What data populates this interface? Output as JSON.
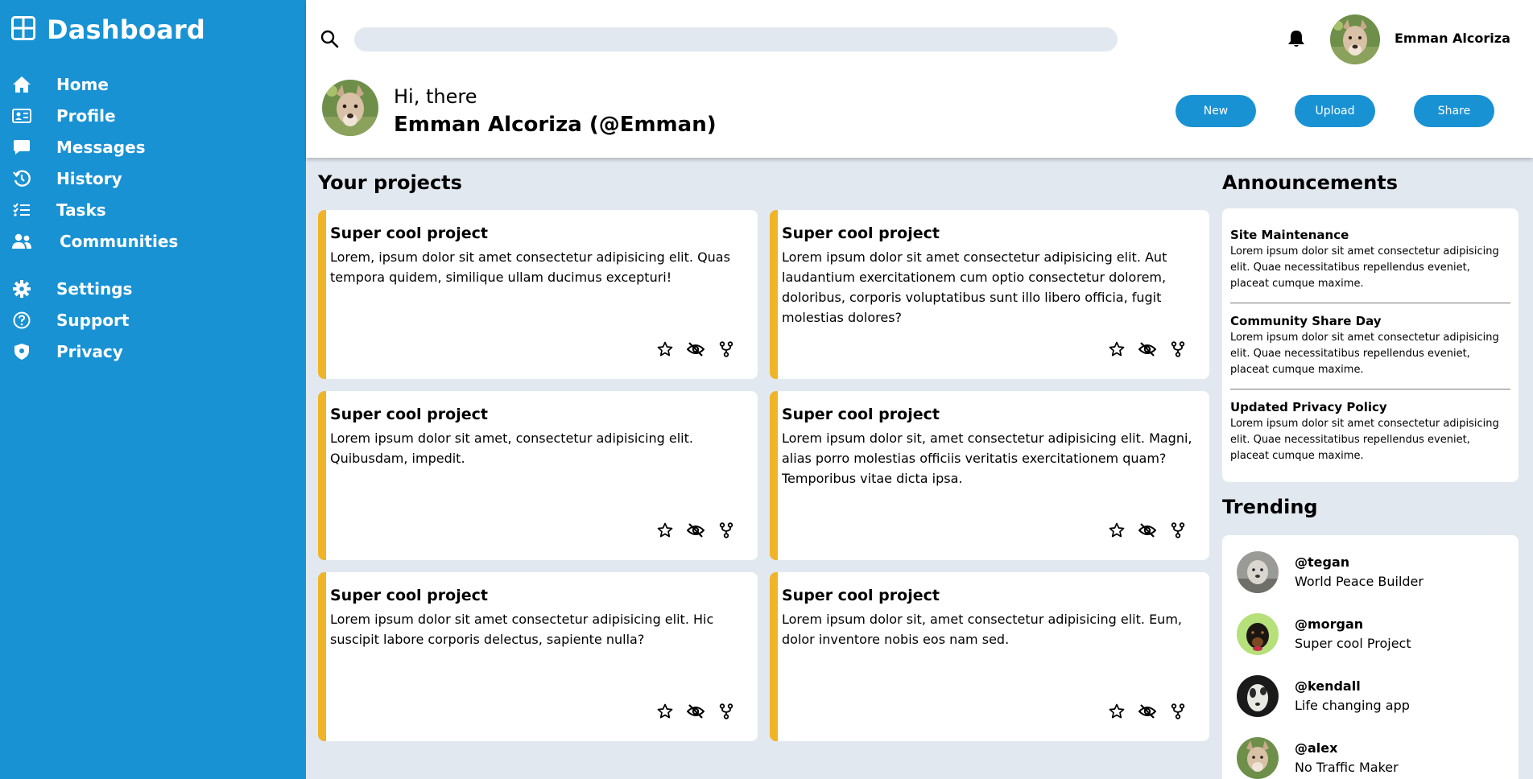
{
  "sidebar": {
    "brand": {
      "title": "Dashboard",
      "icon": "grid-icon"
    },
    "items": [
      {
        "label": "Home",
        "icon": "home-icon"
      },
      {
        "label": "Profile",
        "icon": "id-card-icon"
      },
      {
        "label": "Messages",
        "icon": "message-icon"
      },
      {
        "label": "History",
        "icon": "history-icon"
      },
      {
        "label": "Tasks",
        "icon": "tasks-icon"
      },
      {
        "label": "Communities",
        "icon": "users-icon"
      },
      {
        "label": "Settings",
        "icon": "gear-icon"
      },
      {
        "label": "Support",
        "icon": "help-icon"
      },
      {
        "label": "Privacy",
        "icon": "shield-icon"
      }
    ]
  },
  "header": {
    "search": {
      "placeholder": ""
    },
    "user": {
      "name": "Emman Alcoriza"
    },
    "greeting": "Hi, there",
    "greeting_name": "Emman Alcoriza (@Emman)",
    "buttons": {
      "new": "New",
      "upload": "Upload",
      "share": "Share"
    }
  },
  "projects": {
    "title": "Your projects",
    "cards": [
      {
        "title": "Super cool project",
        "text": "Lorem, ipsum dolor sit amet consectetur adipisicing elit. Quas tempora quidem, similique ullam ducimus excepturi!"
      },
      {
        "title": "Super cool project",
        "text": "Lorem ipsum dolor sit amet consectetur adipisicing elit. Aut laudantium exercitationem cum optio consectetur dolorem, doloribus, corporis voluptatibus sunt illo libero officia, fugit molestias dolores?"
      },
      {
        "title": "Super cool project",
        "text": "Lorem ipsum dolor sit amet, consectetur adipisicing elit. Quibusdam, impedit."
      },
      {
        "title": "Super cool project",
        "text": "Lorem ipsum dolor sit, amet consectetur adipisicing elit. Magni, alias porro molestias officiis veritatis exercitationem quam? Temporibus vitae dicta ipsa."
      },
      {
        "title": "Super cool project",
        "text": "Lorem ipsum dolor sit amet consectetur adipisicing elit. Hic suscipit labore corporis delectus, sapiente nulla?"
      },
      {
        "title": "Super cool project",
        "text": "Lorem ipsum dolor sit, amet consectetur adipisicing elit. Eum, dolor inventore nobis eos nam sed."
      }
    ],
    "card_icons": [
      "star-icon",
      "eye-off-icon",
      "fork-icon"
    ]
  },
  "announcements": {
    "title": "Announcements",
    "items": [
      {
        "title": "Site Maintenance",
        "text": "Lorem ipsum dolor sit amet consectetur adipisicing elit. Quae necessitatibus repellendus eveniet, placeat cumque maxime."
      },
      {
        "title": "Community Share Day",
        "text": "Lorem ipsum dolor sit amet consectetur adipisicing elit. Quae necessitatibus repellendus eveniet, placeat cumque maxime."
      },
      {
        "title": "Updated Privacy Policy",
        "text": "Lorem ipsum dolor sit amet consectetur adipisicing elit. Quae necessitatibus repellendus eveniet, placeat cumque maxime."
      }
    ]
  },
  "trending": {
    "title": "Trending",
    "items": [
      {
        "handle": "@tegan",
        "desc": "World Peace Builder"
      },
      {
        "handle": "@morgan",
        "desc": "Super cool Project"
      },
      {
        "handle": "@kendall",
        "desc": "Life changing app"
      },
      {
        "handle": "@alex",
        "desc": "No Traffic Maker"
      }
    ]
  },
  "colors": {
    "sidebar": "#1992d4",
    "accent": "#f0b429",
    "background": "#e2e8f0",
    "card": "#ffffff"
  }
}
